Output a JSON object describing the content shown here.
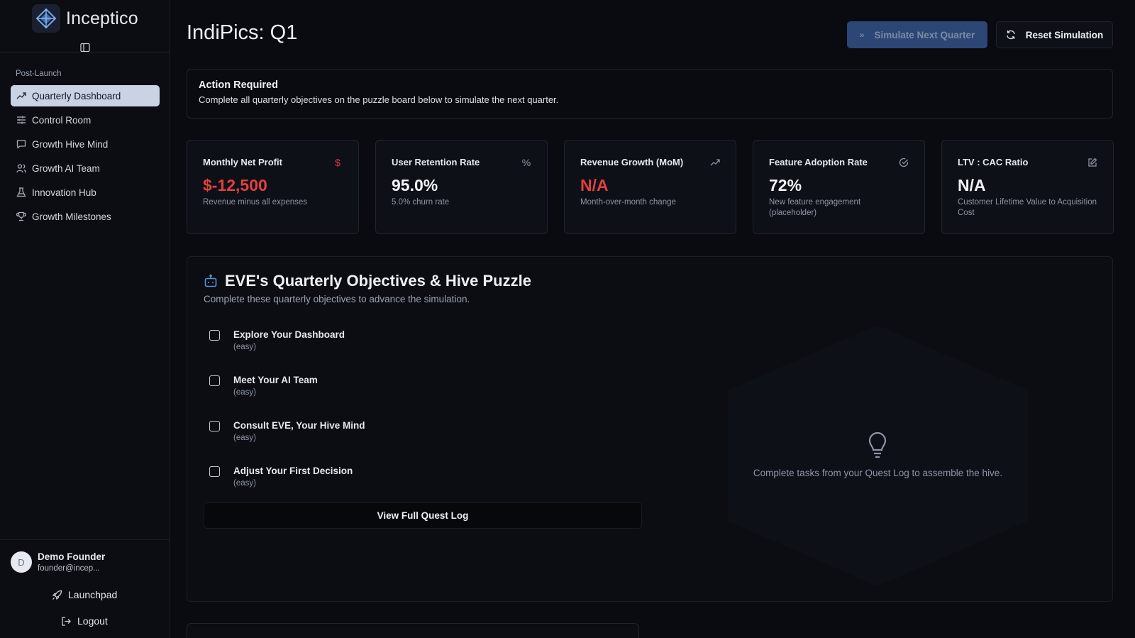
{
  "brand": {
    "name": "Inceptico"
  },
  "sidebar": {
    "section_label": "Post-Launch",
    "items": [
      {
        "label": "Quarterly Dashboard",
        "icon": "trending-up-icon",
        "active": true
      },
      {
        "label": "Control Room",
        "icon": "sliders-icon"
      },
      {
        "label": "Growth Hive Mind",
        "icon": "message-square-icon"
      },
      {
        "label": "Growth AI Team",
        "icon": "users-icon"
      },
      {
        "label": "Innovation Hub",
        "icon": "flask-icon"
      },
      {
        "label": "Growth Milestones",
        "icon": "trophy-icon"
      }
    ]
  },
  "user": {
    "initial": "D",
    "name": "Demo Founder",
    "email": "founder@incep..."
  },
  "bottom_links": {
    "launchpad": "Launchpad",
    "logout": "Logout"
  },
  "page": {
    "title": "IndiPics: Q1"
  },
  "actions": {
    "simulate": "Simulate Next Quarter",
    "reset": "Reset Simulation"
  },
  "alert": {
    "title": "Action Required",
    "text": "Complete all quarterly objectives on the puzzle board below to simulate the next quarter."
  },
  "kpis": [
    {
      "title": "Monthly Net Profit",
      "value": "$-12,500",
      "sub": "Revenue minus all expenses",
      "icon": "dollar-icon",
      "negative": true
    },
    {
      "title": "User Retention Rate",
      "value": "95.0%",
      "sub": "5.0% churn rate",
      "icon": "percent-icon"
    },
    {
      "title": "Revenue Growth (MoM)",
      "value": "N/A",
      "sub": "Month-over-month change",
      "icon": "trending-up-icon",
      "negative": true
    },
    {
      "title": "Feature Adoption Rate",
      "value": "72%",
      "sub": "New feature engagement (placeholder)",
      "icon": "check-circle-icon"
    },
    {
      "title": "LTV : CAC Ratio",
      "value": "N/A",
      "sub": "Customer Lifetime Value to Acquisition Cost",
      "icon": "edit-icon"
    }
  ],
  "objectives": {
    "title": "EVE's Quarterly Objectives & Hive Puzzle",
    "subtitle": "Complete these quarterly objectives to advance the simulation.",
    "tasks": [
      {
        "title": "Explore Your Dashboard",
        "difficulty": "(easy)",
        "checked": false
      },
      {
        "title": "Meet Your AI Team",
        "difficulty": "(easy)",
        "checked": false
      },
      {
        "title": "Consult EVE, Your Hive Mind",
        "difficulty": "(easy)",
        "checked": false
      },
      {
        "title": "Adjust Your First Decision",
        "difficulty": "(easy)",
        "checked": false
      }
    ],
    "quest_button": "View Full Quest Log",
    "hive_text": "Complete tasks from your Quest Log to assemble the hive."
  },
  "colors": {
    "accent": "#2c4675",
    "negative": "#e2403f",
    "active_nav": "#c9d3e3"
  }
}
